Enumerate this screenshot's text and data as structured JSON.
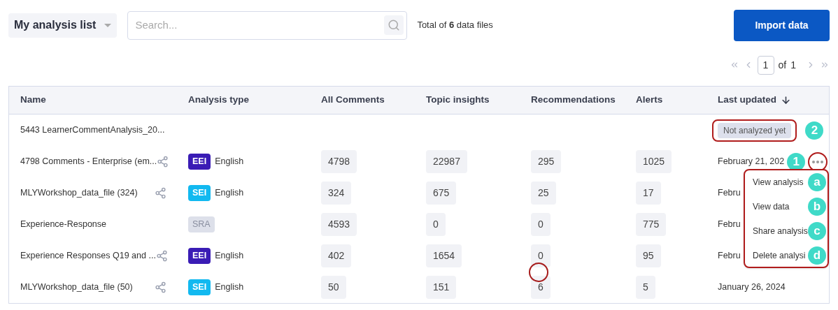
{
  "list_selector": {
    "label": "My analysis list"
  },
  "search": {
    "placeholder": "Search..."
  },
  "total": "Total of **6** data files",
  "import_button": "Import data",
  "pagination": {
    "page": "1",
    "of": "of",
    "total": "1"
  },
  "table": {
    "columns": [
      {
        "label": "Name",
        "sorted": false
      },
      {
        "label": "Analysis type",
        "sorted": false
      },
      {
        "label": "All Comments",
        "sorted": false
      },
      {
        "label": "Topic insights",
        "sorted": false
      },
      {
        "label": "Recommendations",
        "sorted": false
      },
      {
        "label": "Alerts",
        "sorted": false
      },
      {
        "label": "Last updated",
        "sorted": true
      }
    ],
    "rows": [
      {
        "name": "5443 LearnerCommentAnalysis_20...",
        "shared": false,
        "status": "Not analyzed yet",
        "callout": "2",
        "menu_open": false
      },
      {
        "name": "4798 Comments - Enterprise (em...",
        "shared": true,
        "type": {
          "label": "EEI",
          "kind": "eei"
        },
        "language": "English",
        "counts": [
          "4798",
          "22987",
          "295",
          "1025"
        ],
        "last_updated": "February 21, 202",
        "callout": "1",
        "menu_open": true
      },
      {
        "name": "MLYWorkshop_data_file (324)",
        "shared": true,
        "type": {
          "label": "SEI",
          "kind": "sei"
        },
        "language": "English",
        "counts": [
          "324",
          "675",
          "25",
          "17"
        ],
        "last_updated": "Febru",
        "menu_open": false
      },
      {
        "name": "Experience-Response",
        "shared": false,
        "type": {
          "label": "SRA",
          "kind": "sra"
        },
        "counts": [
          "4593",
          "0",
          "0",
          "775"
        ],
        "last_updated": "Febru",
        "menu_open": false
      },
      {
        "name": "Experience Responses Q19 and ...",
        "shared": true,
        "type": {
          "label": "EEI",
          "kind": "eei"
        },
        "language": "English",
        "counts": [
          "402",
          "1654",
          "0",
          "95"
        ],
        "last_updated": "Febru",
        "menu_open": false
      },
      {
        "name": "MLYWorkshop_data_file (50)",
        "shared": true,
        "type": {
          "label": "SEI",
          "kind": "sei"
        },
        "language": "English",
        "counts": [
          "50",
          "151",
          "6",
          "5"
        ],
        "last_updated": "January 26, 2024",
        "menu_open": false
      }
    ]
  },
  "row_menu": {
    "items": [
      {
        "label": "View analysis",
        "callout": "a"
      },
      {
        "label": "View data",
        "callout": "b"
      },
      {
        "label": "Share analysis",
        "callout": "c"
      },
      {
        "label": "Delete analysi",
        "callout": "d"
      }
    ]
  }
}
